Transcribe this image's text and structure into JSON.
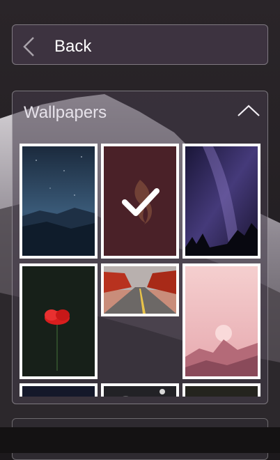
{
  "header": {
    "back_label": "Back",
    "back_icon": "chevron-left-icon"
  },
  "wallpapers_panel": {
    "title": "Wallpapers",
    "collapse_icon": "chevron-up-icon",
    "selected_index": 1,
    "items": [
      {
        "name": "night-sky-mountains",
        "selected": false
      },
      {
        "name": "flame-on-maroon",
        "selected": true
      },
      {
        "name": "milky-way-trees",
        "selected": false
      },
      {
        "name": "red-poppy",
        "selected": false
      },
      {
        "name": "autumn-road",
        "selected": false
      },
      {
        "name": "pink-sunset-mountains",
        "selected": false
      },
      {
        "name": "partial-dark-1",
        "selected": false
      },
      {
        "name": "partial-moon",
        "selected": false
      },
      {
        "name": "partial-dark-2",
        "selected": false
      }
    ]
  },
  "colors": {
    "panel_border": "#ffffff",
    "selection_check": "#ffffff",
    "maroon": "#4a2128"
  }
}
